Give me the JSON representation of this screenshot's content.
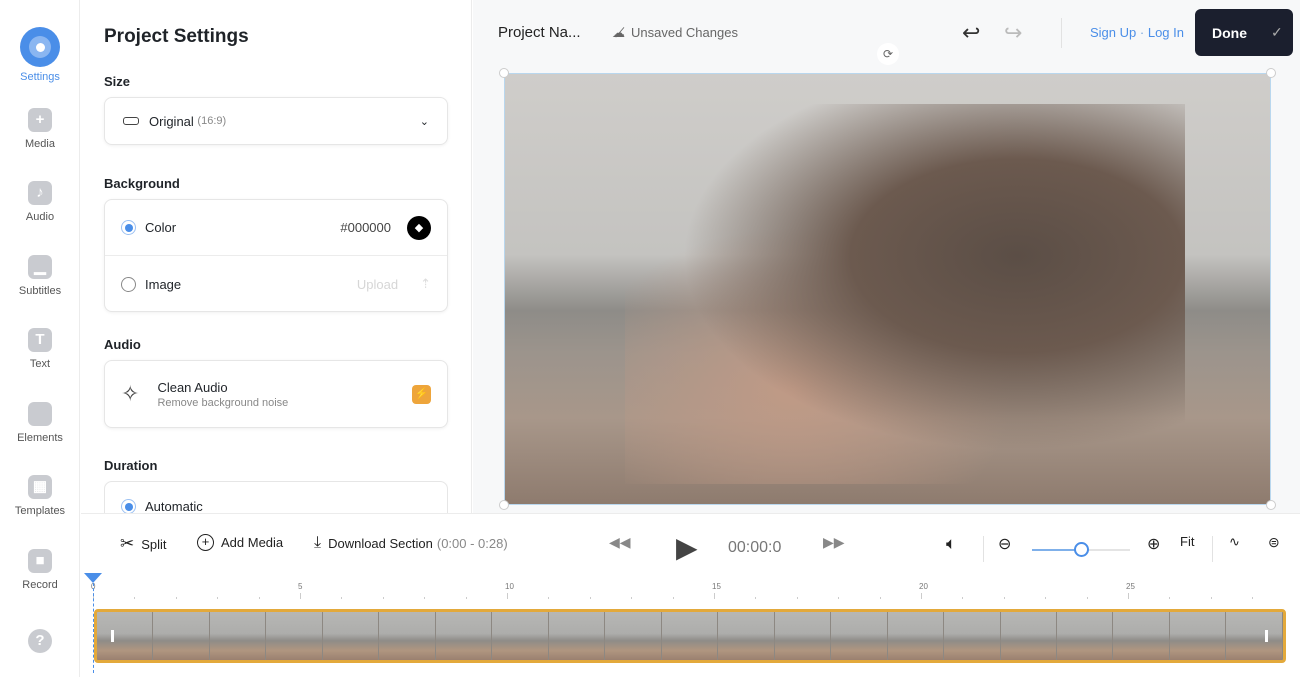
{
  "sidebar": {
    "items": [
      {
        "label": "Settings",
        "icon": "settings-icon",
        "active": true
      },
      {
        "label": "Media",
        "icon": "plus-icon"
      },
      {
        "label": "Audio",
        "icon": "music-note-icon"
      },
      {
        "label": "Subtitles",
        "icon": "subtitles-icon"
      },
      {
        "label": "Text",
        "icon": "text-icon"
      },
      {
        "label": "Elements",
        "icon": "elements-icon"
      },
      {
        "label": "Templates",
        "icon": "templates-icon"
      },
      {
        "label": "Record",
        "icon": "camera-icon"
      }
    ],
    "help_icon": "help-icon"
  },
  "panel": {
    "title": "Project Settings",
    "size": {
      "label": "Size",
      "value": "Original",
      "ratio": "(16:9)"
    },
    "background": {
      "label": "Background",
      "color_label": "Color",
      "color_value": "#000000",
      "image_label": "Image",
      "upload_label": "Upload",
      "selected": "Color"
    },
    "audio": {
      "label": "Audio",
      "title": "Clean Audio",
      "subtitle": "Remove background noise"
    },
    "duration": {
      "label": "Duration",
      "option": "Automatic"
    }
  },
  "header": {
    "project_name": "Project Na...",
    "save_status": "Unsaved Changes",
    "sign_up": "Sign Up",
    "separator": "·",
    "log_in": "Log In",
    "done": "Done"
  },
  "timeline": {
    "split": "Split",
    "add_media": "Add Media",
    "download": "Download Section",
    "download_range": "(0:00 - 0:28)",
    "time": "00:00:0",
    "fit": "Fit",
    "zoom_level": 0.5,
    "ticks": [
      "0",
      "5",
      "10",
      "15",
      "20",
      "25"
    ]
  },
  "colors": {
    "accent": "#4a8ee8",
    "done_bg": "#1b1f2e",
    "clip_border": "#e3a93b"
  }
}
